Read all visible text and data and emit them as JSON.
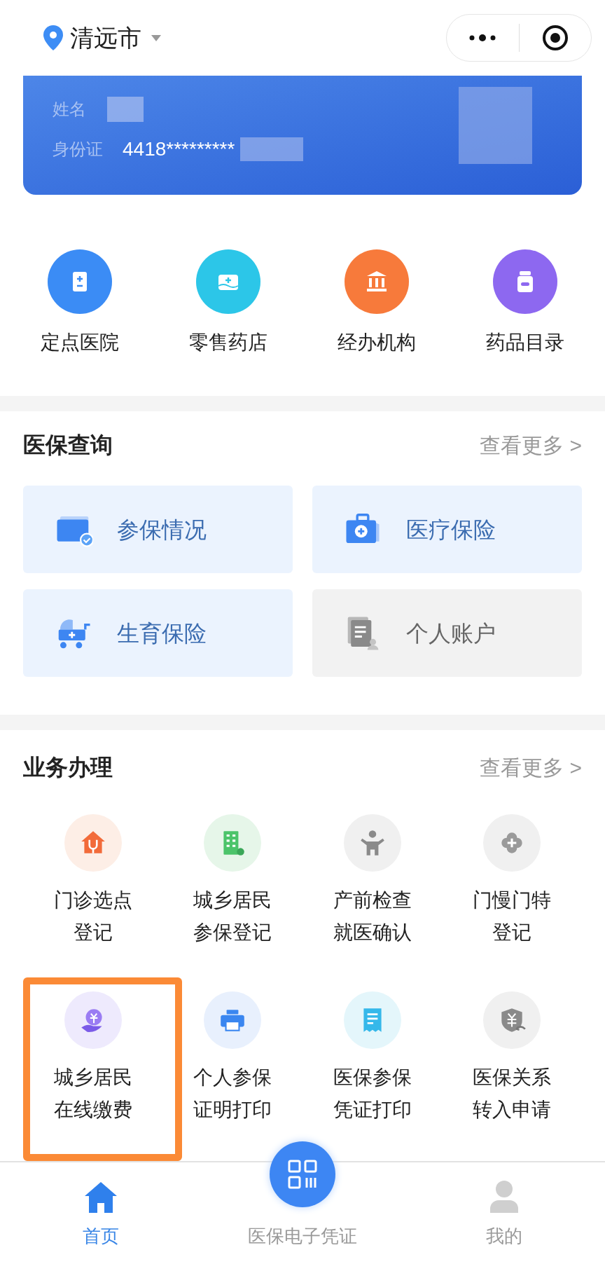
{
  "location": {
    "city": "清远市"
  },
  "card": {
    "name_label": "姓名",
    "id_label": "身份证",
    "id_value": "4418*********"
  },
  "shortcuts": [
    {
      "label": "定点医院"
    },
    {
      "label": "零售药店"
    },
    {
      "label": "经办机构"
    },
    {
      "label": "药品目录"
    }
  ],
  "query": {
    "title": "医保查询",
    "more": "查看更多 >",
    "tiles": [
      {
        "label": "参保情况",
        "disabled": false
      },
      {
        "label": "医疗保险",
        "disabled": false
      },
      {
        "label": "生育保险",
        "disabled": false
      },
      {
        "label": "个人账户",
        "disabled": true
      }
    ]
  },
  "services": {
    "title": "业务办理",
    "more": "查看更多 >",
    "items": [
      {
        "lines": [
          "门诊选点",
          "登记"
        ],
        "highlighted": false
      },
      {
        "lines": [
          "城乡居民",
          "参保登记"
        ],
        "highlighted": false
      },
      {
        "lines": [
          "产前检查",
          "就医确认"
        ],
        "highlighted": false
      },
      {
        "lines": [
          "门慢门特",
          "登记"
        ],
        "highlighted": false
      },
      {
        "lines": [
          "城乡居民",
          "在线缴费"
        ],
        "highlighted": true
      },
      {
        "lines": [
          "个人参保",
          "证明打印"
        ],
        "highlighted": false
      },
      {
        "lines": [
          "医保参保",
          "凭证打印"
        ],
        "highlighted": false
      },
      {
        "lines": [
          "医保关系",
          "转入申请"
        ],
        "highlighted": false
      }
    ]
  },
  "tabbar": [
    {
      "label": "首页",
      "kind": "tab",
      "selected": true
    },
    {
      "label": "医保电子凭证",
      "kind": "center",
      "selected": false
    },
    {
      "label": "我的",
      "kind": "tab",
      "selected": false
    }
  ]
}
